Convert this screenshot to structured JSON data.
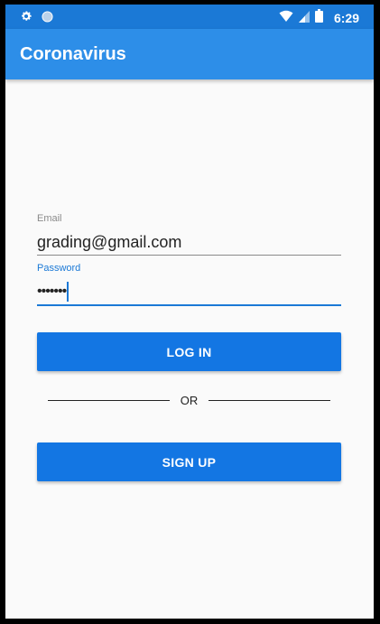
{
  "status_bar": {
    "time": "6:29",
    "icons": [
      "gear-icon",
      "circle-icon",
      "wifi-icon",
      "signal-icon",
      "battery-icon"
    ]
  },
  "app_bar": {
    "title": "Coronavirus"
  },
  "form": {
    "email_label": "Email",
    "email_value": "grading@gmail.com",
    "password_label": "Password",
    "password_value": "•••••••"
  },
  "buttons": {
    "login_label": "LOG IN",
    "signup_label": "SIGN UP"
  },
  "divider": {
    "text": "OR"
  },
  "colors": {
    "status_bar": "#1b79d6",
    "app_bar": "#2d8ee8",
    "button": "#1376e3",
    "accent": "#1b79d6"
  }
}
